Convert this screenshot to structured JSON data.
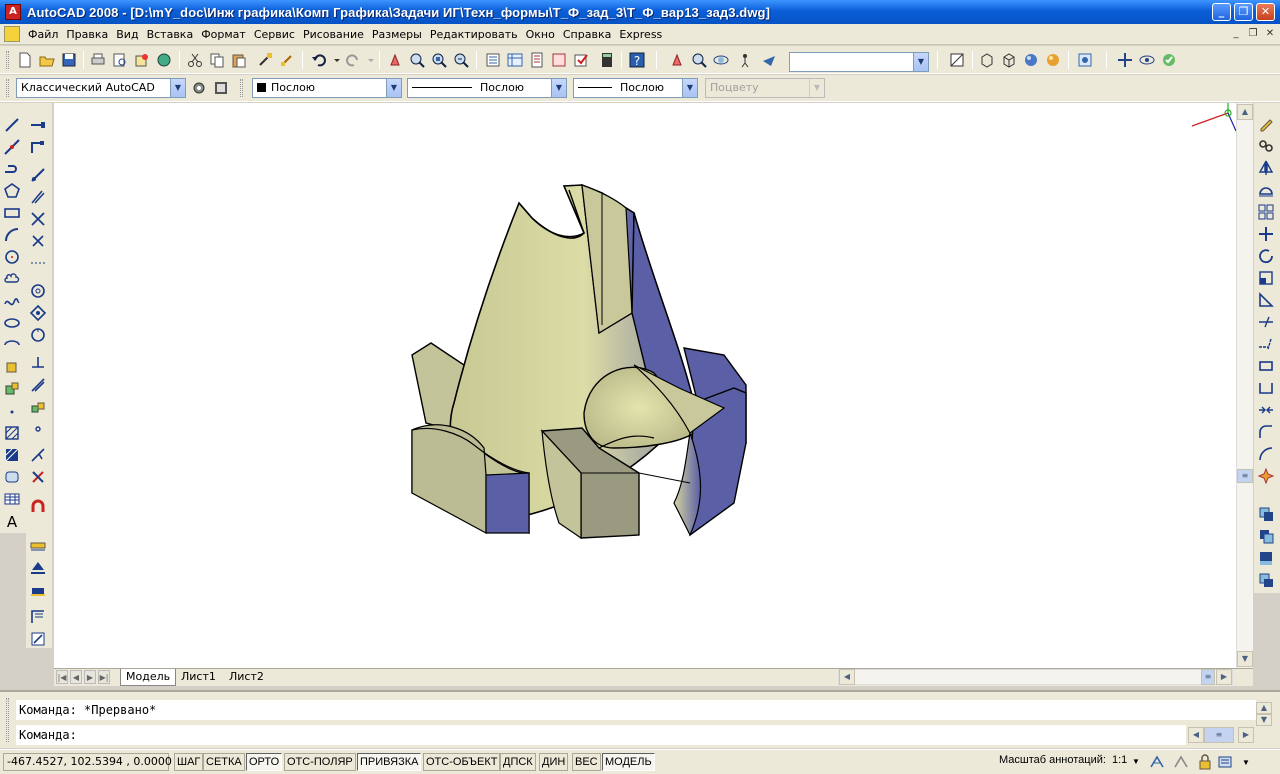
{
  "window": {
    "title": "AutoCAD 2008 - [D:\\mY_doc\\Инж графика\\Комп Графика\\Задачи ИГ\\Техн_формы\\Т_Ф_зад_3\\Т_Ф_вар13_зад3.dwg]",
    "app_icon_label": "A"
  },
  "menu": {
    "items": [
      "Файл",
      "Правка",
      "Вид",
      "Вставка",
      "Формат",
      "Сервис",
      "Рисование",
      "Размеры",
      "Редактировать",
      "Окно",
      "Справка",
      "Express"
    ]
  },
  "workspace": {
    "value": "Классический AutoCAD"
  },
  "properties": {
    "color": "Послою",
    "linetype": "Послою",
    "lineweight": "Послою",
    "plotstyle": "Поцвету"
  },
  "tabs": [
    "Модель",
    "Лист1",
    "Лист2"
  ],
  "active_tab": "Модель",
  "command": {
    "history": "Команда: *Прервано*",
    "prompt": "Команда:"
  },
  "status": {
    "coords": "-467.4527, 102.5394 , 0.0000",
    "toggles": [
      {
        "label": "ШАГ",
        "on": false
      },
      {
        "label": "СЕТКА",
        "on": false
      },
      {
        "label": "ОРТО",
        "on": true
      },
      {
        "label": "ОТС-ПОЛЯР",
        "on": false
      },
      {
        "label": "ПРИВЯЗКА",
        "on": true
      },
      {
        "label": "ОТС-ОБЪЕКТ",
        "on": false
      },
      {
        "label": "ДПСК",
        "on": false
      },
      {
        "label": "ДИН",
        "on": false
      },
      {
        "label": "ВЕС",
        "on": false
      },
      {
        "label": "МОДЕЛЬ",
        "on": true
      }
    ],
    "annotation_scale_label": "Масштаб аннотаций:",
    "annotation_scale_value": "1:1"
  },
  "colors": {
    "solid_face_light": "#d8d8a0",
    "solid_face_shade": "#5a5fa6",
    "solid_face_dark": "#9a9a78",
    "titlebar": "#0a5fd8"
  }
}
